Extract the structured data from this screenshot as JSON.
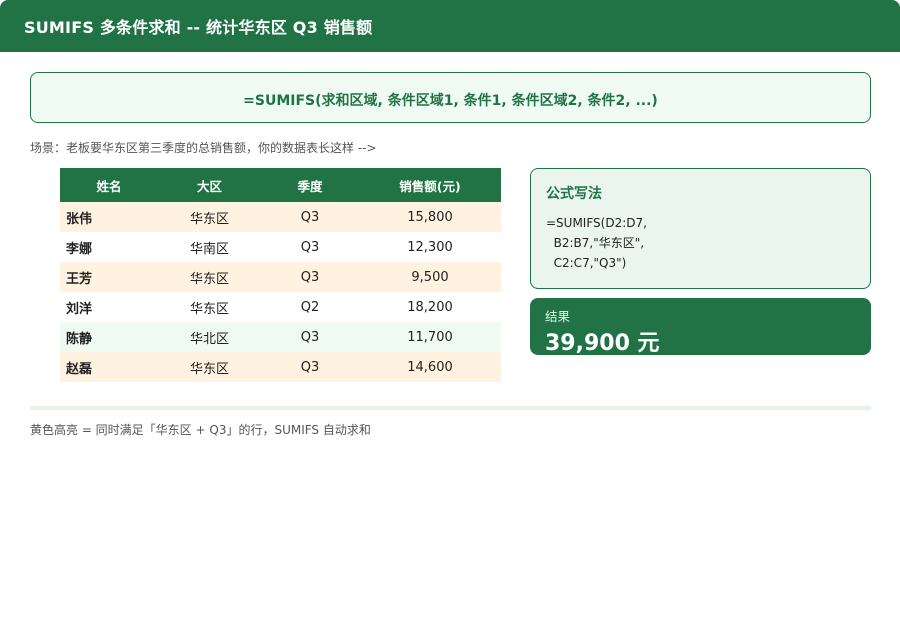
{
  "header": {
    "title": "SUMIFS 多条件求和 -- 统计华东区 Q3 销售额"
  },
  "formula_bar": {
    "text": "=SUMIFS(求和区域, 条件区域1, 条件1, 条件区域2, 条件2, ...)"
  },
  "scenario": {
    "text": "场景：老板要华东区第三季度的总销售额，你的数据表长这样 -->"
  },
  "table": {
    "headers": [
      "姓名",
      "大区",
      "季度",
      "销售额(元)"
    ],
    "rows": [
      {
        "name": "张伟",
        "region": "华东区",
        "quarter": "Q3",
        "sales": "15,800",
        "style": "hl"
      },
      {
        "name": "李娜",
        "region": "华南区",
        "quarter": "Q3",
        "sales": "12,300",
        "style": "plain"
      },
      {
        "name": "王芳",
        "region": "华东区",
        "quarter": "Q3",
        "sales": "9,500",
        "style": "hl"
      },
      {
        "name": "刘洋",
        "region": "华东区",
        "quarter": "Q2",
        "sales": "18,200",
        "style": "plain"
      },
      {
        "name": "陈静",
        "region": "华北区",
        "quarter": "Q3",
        "sales": "11,700",
        "style": "mint"
      },
      {
        "name": "赵磊",
        "region": "华东区",
        "quarter": "Q3",
        "sales": "14,600",
        "style": "hl"
      }
    ]
  },
  "formula_card": {
    "title": "公式写法",
    "lines": [
      "=SUMIFS(D2:D7,",
      "  B2:B7,\"华东区\",",
      "  C2:C7,\"Q3\")"
    ]
  },
  "result_card": {
    "label": "结果",
    "value": "39,900 元"
  },
  "footnote": {
    "text": "黄色高亮 = 同时满足「华东区 + Q3」的行，SUMIFS 自动求和"
  },
  "colors": {
    "brand_green": "#217346",
    "highlight_yellow": "#fff2e0",
    "mint": "#effaf3"
  }
}
